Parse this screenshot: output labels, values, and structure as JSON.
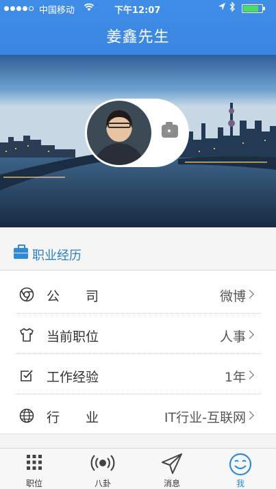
{
  "status_bar": {
    "carrier": "中国移动",
    "time": "下午12:07",
    "battery_level": 0.8
  },
  "nav": {
    "title": "姜鑫先生"
  },
  "section": {
    "title": "职业经历"
  },
  "rows": [
    {
      "icon": "chrome-icon",
      "label": "公　　司",
      "value": "微博"
    },
    {
      "icon": "tshirt-icon",
      "label": "当前职位",
      "value": "人事"
    },
    {
      "icon": "checkbox-icon",
      "label": "工作经验",
      "value": "1年"
    },
    {
      "icon": "globe-icon",
      "label": "行　　业",
      "value": "IT行业-互联网"
    }
  ],
  "tabs": [
    {
      "icon": "grid-icon",
      "label": "职位"
    },
    {
      "icon": "broadcast-icon",
      "label": "八卦"
    },
    {
      "icon": "paper-plane-icon",
      "label": "消息"
    },
    {
      "icon": "smile-icon",
      "label": "我",
      "active": true
    }
  ],
  "colors": {
    "accent": "#2d8bd7",
    "nav_bg": "#3f8ee8"
  }
}
